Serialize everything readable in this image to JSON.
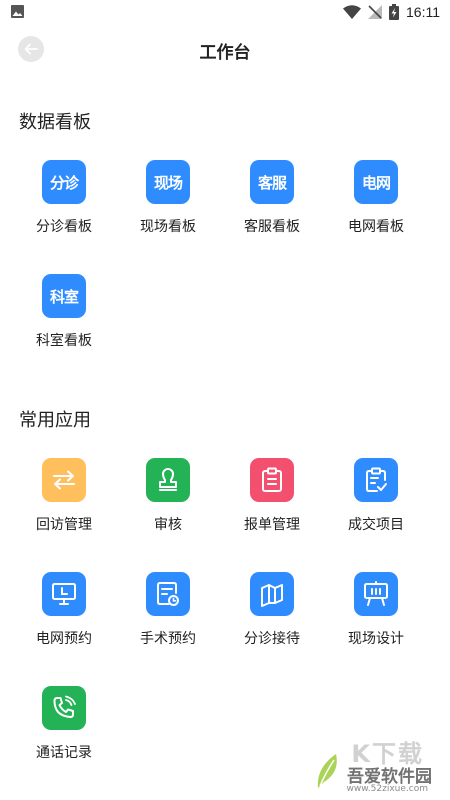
{
  "status_bar": {
    "time": "16:11"
  },
  "header": {
    "title": "工作台"
  },
  "colors": {
    "blue": "#2f8cff",
    "orange": "#ffbf5c",
    "green": "#23b255",
    "red": "#f2506e"
  },
  "data_board": {
    "title": "数据看板",
    "items": [
      {
        "icon_text": "分诊",
        "label": "分诊看板"
      },
      {
        "icon_text": "现场",
        "label": "现场看板"
      },
      {
        "icon_text": "客服",
        "label": "客服看板"
      },
      {
        "icon_text": "电网",
        "label": "电网看板"
      },
      {
        "icon_text": "科室",
        "label": "科室看板"
      }
    ]
  },
  "common_apps": {
    "title": "常用应用",
    "items": [
      {
        "icon": "swap-arrows-icon",
        "label": "回访管理"
      },
      {
        "icon": "stamp-icon",
        "label": "审核"
      },
      {
        "icon": "clipboard-icon",
        "label": "报单管理"
      },
      {
        "icon": "clipboard-check-icon",
        "label": "成交项目"
      },
      {
        "icon": "monitor-icon",
        "label": "电网预约"
      },
      {
        "icon": "form-clock-icon",
        "label": "手术预约"
      },
      {
        "icon": "map-fold-icon",
        "label": "分诊接待"
      },
      {
        "icon": "easel-icon",
        "label": "现场设计"
      },
      {
        "icon": "phone-icon",
        "label": "通话记录"
      }
    ]
  },
  "watermark": {
    "logo_text": "K下载",
    "name": "吾爱软件园",
    "url": "www.52zixue.com"
  }
}
